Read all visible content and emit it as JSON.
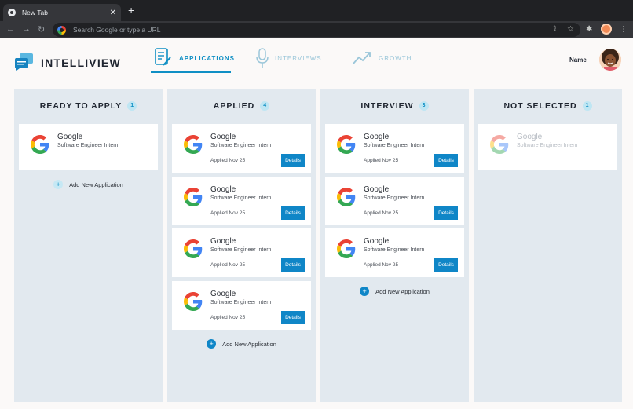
{
  "browser": {
    "tab_title": "New Tab",
    "omnibox_placeholder": "Search Google or type a URL"
  },
  "header": {
    "brand": "INTELLIVIEW",
    "nav": [
      {
        "label": "APPLICATIONS",
        "active": true
      },
      {
        "label": "INTERVIEWS",
        "active": false
      },
      {
        "label": "GROWTH",
        "active": false
      }
    ],
    "user_name": "Name"
  },
  "colors": {
    "accent": "#0f8fc4",
    "button": "#0f86c7",
    "column_bg": "#e2e9ef",
    "card_bg": "#ffffff"
  },
  "columns": [
    {
      "title": "READY TO APPLY",
      "count": "1",
      "cards": [
        {
          "company": "Google",
          "role": "Software Engineer Intern"
        }
      ],
      "add_label": "Add New Application"
    },
    {
      "title": "APPLIED",
      "count": "4",
      "cards": [
        {
          "company": "Google",
          "role": "Software Engineer Intern",
          "date": "Applied Nov 25",
          "button": "Details"
        },
        {
          "company": "Google",
          "role": "Software Engineer Intern",
          "date": "Applied Nov 25",
          "button": "Details"
        },
        {
          "company": "Google",
          "role": "Software Engineer Intern",
          "date": "Applied Nov 25",
          "button": "Details"
        },
        {
          "company": "Google",
          "role": "Software Engineer Intern",
          "date": "Applied Nov 25",
          "button": "Details"
        }
      ],
      "add_label": "Add New Application"
    },
    {
      "title": "INTERVIEW",
      "count": "3",
      "cards": [
        {
          "company": "Google",
          "role": "Software Engineer Intern",
          "date": "Applied Nov 25",
          "button": "Details"
        },
        {
          "company": "Google",
          "role": "Software Engineer Intern",
          "date": "Applied Nov 25",
          "button": "Details"
        },
        {
          "company": "Google",
          "role": "Software Engineer Intern",
          "date": "Applied Nov 25",
          "button": "Details"
        }
      ],
      "add_label": "Add New Application"
    },
    {
      "title": "NOT SELECTED",
      "count": "1",
      "cards": [
        {
          "company": "Google",
          "role": "Software Engineer Intern"
        }
      ]
    }
  ]
}
